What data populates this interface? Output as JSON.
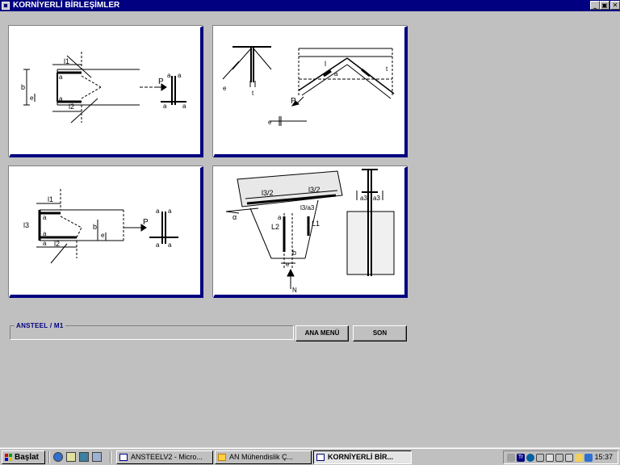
{
  "window": {
    "title": "KORNİYERLİ BİRLEŞİMLER",
    "minimize_glyph": "_",
    "maximize_glyph": "▣",
    "close_glyph": "✕"
  },
  "panels": {
    "p1": {
      "labels": [
        "l1",
        "a",
        "a",
        "l2",
        "b",
        "e",
        "a",
        "a",
        "a",
        "a",
        "P"
      ]
    },
    "p2": {
      "labels": [
        "e",
        "t",
        "l",
        "a",
        "t",
        "P",
        "e"
      ]
    },
    "p3": {
      "labels": [
        "l1",
        "a",
        "l3",
        "a",
        "a",
        "l2",
        "b",
        "e",
        "P",
        "a",
        "a",
        "a",
        "a"
      ]
    },
    "p4": {
      "labels": [
        "l3/2",
        "l3/2",
        "l3/a3",
        "α",
        "L2",
        "L1",
        "a",
        "b",
        "e",
        "N",
        "a3",
        "a3"
      ]
    }
  },
  "bottom": {
    "status_label": "ANSTEEL   / M1",
    "main_menu_button": "ANA MENÜ",
    "exit_button": "SON"
  },
  "taskbar": {
    "start_label": "Başlat",
    "tasks": [
      {
        "label": "ANSTEELV2 - Micro...",
        "icon": "word-doc-icon"
      },
      {
        "label": "AN Mühendislik    Ç...",
        "icon": "an-star-icon"
      },
      {
        "label": "KORNİYERLİ BİR...",
        "icon": "app-window-icon",
        "active": true
      }
    ],
    "tray_letters": "Tr",
    "clock": "15:37"
  },
  "colors": {
    "titlebar": "#000080",
    "panel_frame": "#000080",
    "face": "#c0c0c0"
  }
}
